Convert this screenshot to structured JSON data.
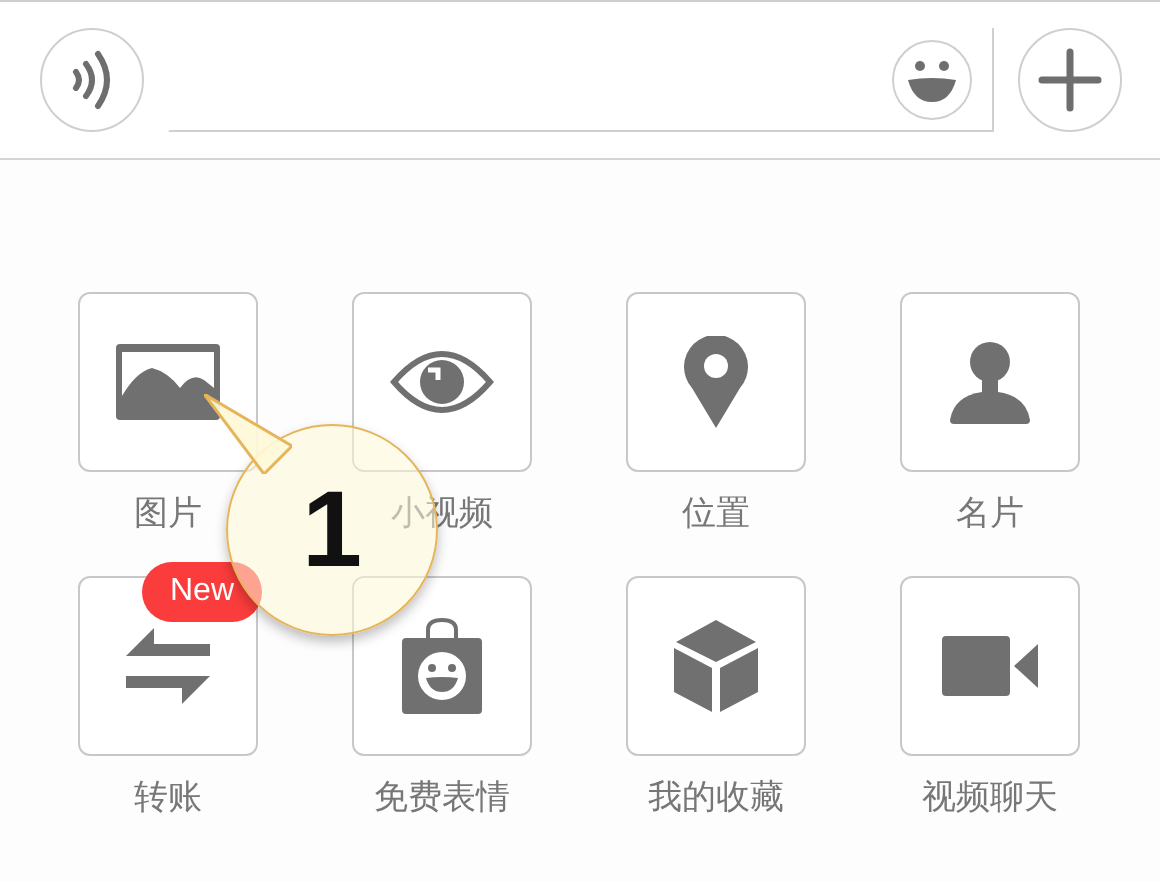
{
  "actions": [
    {
      "label": "图片"
    },
    {
      "label": "小视频"
    },
    {
      "label": "位置"
    },
    {
      "label": "名片"
    },
    {
      "label": "转账",
      "badge": "New"
    },
    {
      "label": "免费表情"
    },
    {
      "label": "我的收藏"
    },
    {
      "label": "视频聊天"
    }
  ],
  "callout": {
    "text": "1"
  }
}
